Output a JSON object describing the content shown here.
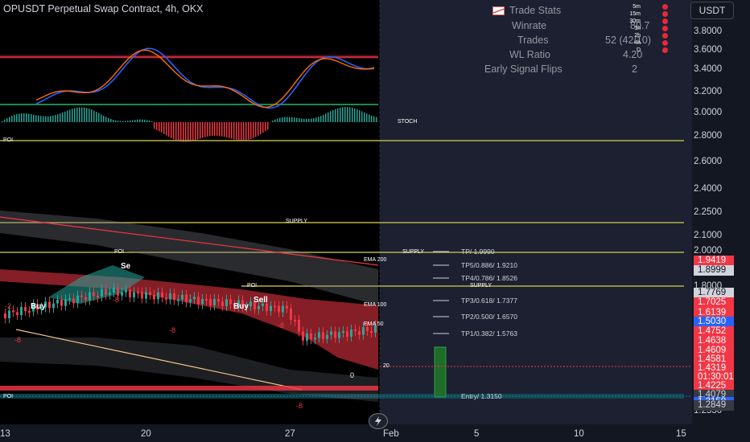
{
  "header": {
    "title": "OPUSDT Perpetual Swap Contract, 4h, OKX",
    "currency": "USDT"
  },
  "trade_stats": {
    "title": "Trade Stats",
    "rows": [
      {
        "label": "Winrate",
        "value": "80.7"
      },
      {
        "label": "Trades",
        "value": "52 (42/10)"
      },
      {
        "label": "WL Ratio",
        "value": "4.20"
      },
      {
        "label": "Early Signal Flips",
        "value": "2"
      }
    ]
  },
  "timeframes": [
    "5m",
    "15m",
    "30m",
    "1h",
    "2h",
    "4h",
    "D"
  ],
  "oscillator": {
    "label": "STOCH",
    "poi_label": "POI"
  },
  "price_axis": {
    "ticks": [
      "3.8000",
      "3.6000",
      "3.4000",
      "3.2000",
      "3.0000",
      "2.8000",
      "2.6000",
      "2.4000",
      "2.2500",
      "2.1000",
      "2.0000",
      "1.8000",
      "1.2550"
    ],
    "badges": [
      {
        "text": "1.9419",
        "bg": "#f23645",
        "fg": "#ffffff"
      },
      {
        "text": "1.8999",
        "bg": "#d1d4dc",
        "fg": "#131722"
      },
      {
        "text": "1.7769",
        "bg": "#d1d4dc",
        "fg": "#131722"
      },
      {
        "text": "1.7025",
        "bg": "#f23645",
        "fg": "#ffffff"
      },
      {
        "text": "1.6139",
        "bg": "#f23645",
        "fg": "#ffffff"
      },
      {
        "text": "1.5030",
        "bg": "#2962ff",
        "fg": "#ffffff"
      },
      {
        "text": "1.4752",
        "bg": "#f23645",
        "fg": "#ffffff"
      },
      {
        "text": "1.4638",
        "bg": "#f23645",
        "fg": "#ffffff"
      },
      {
        "text": "1.4609",
        "bg": "#f23645",
        "fg": "#ffffff"
      },
      {
        "text": "1.4581",
        "bg": "#f23645",
        "fg": "#ffffff"
      },
      {
        "text": "1.4319",
        "bg": "#f23645",
        "fg": "#ffffff"
      },
      {
        "text": "01:30:01",
        "bg": "#f23645",
        "fg": "#ffffff"
      },
      {
        "text": "1.4225",
        "bg": "#f23645",
        "fg": "#ffffff"
      },
      {
        "text": "1.4079",
        "bg": "#363a45",
        "fg": "#d1d4dc"
      },
      {
        "text": "1.3150",
        "bg": "#2962ff",
        "fg": "#ffffff"
      },
      {
        "text": "1.2849",
        "bg": "#363a45",
        "fg": "#d1d4dc"
      }
    ]
  },
  "time_axis": {
    "ticks": [
      "13",
      "20",
      "27",
      "Feb",
      "5",
      "10",
      "15"
    ]
  },
  "zones": {
    "supply": "SUPPLY",
    "poi": "POI"
  },
  "targets": [
    {
      "label": "TP/ 1.9990"
    },
    {
      "label": "TP5/0.886/ 1.9210"
    },
    {
      "label": "TP4/0.786/ 1.8526"
    },
    {
      "label": "TP3/0.618/ 1.7377"
    },
    {
      "label": "TP2/0.500/ 1.6570"
    },
    {
      "label": "TP1/0.382/ 1.5763"
    },
    {
      "label": "Entry/ 1.3150"
    }
  ],
  "ema_labels": [
    "EMA 200",
    "EMA 100",
    "EMA 50",
    "20"
  ],
  "signals": {
    "buy": "Buy",
    "sell": "Sell",
    "sell_short": "Se",
    "count_mark": "-8",
    "zero_mark": "0",
    "minus_two": "-2"
  },
  "colors": {
    "background": "#131722",
    "bull": "#26a69a",
    "bear": "#f23645",
    "stoch_blue": "#2962ff",
    "stoch_orange": "#ff6d00",
    "supply_line": "#b7b04a",
    "poi_line": "#0d5d54"
  }
}
